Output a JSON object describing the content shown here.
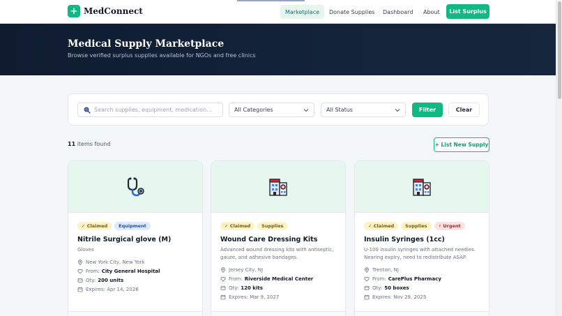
{
  "nav": {
    "logo_icon": "+",
    "brand": "MedConnect",
    "links": [
      "Marketplace",
      "Donate Supplies",
      "Dashboard",
      "About"
    ],
    "cta": "List Surplus"
  },
  "hero": {
    "title": "Medical Supply Marketplace",
    "subtitle": "Browse verified surplus supplies available for NGOs and free clinics"
  },
  "filters": {
    "search_placeholder": "Search supplies, equipment, medication...",
    "category": "All Categories",
    "status": "All Status",
    "filter_label": "Filter",
    "clear_label": "Clear"
  },
  "results": {
    "count": "11",
    "suffix": "items found",
    "list_new": "+ List New Supply"
  },
  "cards": [
    {
      "icon": "stethoscope-icon",
      "tags": [
        "✓ Claimed",
        "Equipment"
      ],
      "title": "Nitrile Surgical glove (M)",
      "desc": "Gloves",
      "location": "New York City, New York",
      "from_label": "From:",
      "from": "City General Hospital",
      "qty_label": "Qty:",
      "qty": "200 units",
      "expires": "Expires: Apr 14, 2026"
    },
    {
      "icon": "hospital-icon",
      "tags": [
        "✓ Claimed",
        "Supplies"
      ],
      "title": "Wound Care Dressing Kits",
      "desc": "Advanced wound dressing kits with antiseptic, gauze, and adhesive bandages.",
      "location": "Jersey City, NJ",
      "from_label": "From:",
      "from": "Riverside Medical Center",
      "qty_label": "Qty:",
      "qty": "120 kits",
      "expires": "Expires: Mar 9, 2027"
    },
    {
      "icon": "hospital-icon",
      "tags": [
        "✓ Claimed",
        "Supplies",
        "⚡ Urgent"
      ],
      "title": "Insulin Syringes (1cc)",
      "desc": "U-100 insulin syringes with attached needles. Nearing expiry, need to redistribute ASAP.",
      "location": "Trenton, NJ",
      "from_label": "From:",
      "from": "CarePlus Pharmacy",
      "qty_label": "Qty:",
      "qty": "50 boxes",
      "expires": "Expires: Nov 29, 2025"
    }
  ],
  "colors": {
    "accent": "#10b981",
    "hero_bg": "#0f1c30",
    "card_image_bg": "#e6f7ef"
  }
}
